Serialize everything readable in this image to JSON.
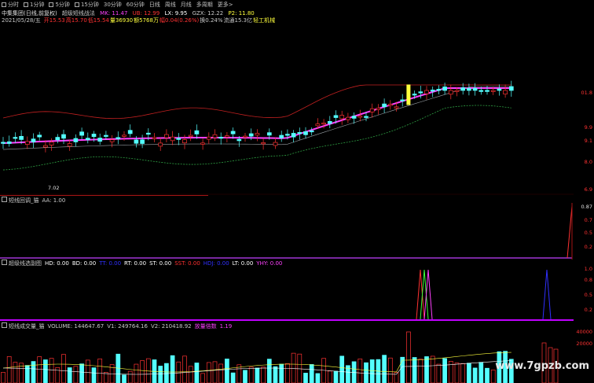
{
  "toolbar": {
    "items": [
      "分时",
      "1分钟",
      "5分钟",
      "15分钟",
      "30分钟",
      "60分钟",
      "日线",
      "周线",
      "月线",
      "多周期",
      "更多>"
    ]
  },
  "main": {
    "title_row": {
      "stock": "中集集团(日线,前复权)",
      "indicator": "超级短线战法",
      "mk": "MK: 11.47",
      "ub": "UB: 12.99",
      "lx": "LX: 9.95",
      "gzx": "GZX: 12.22",
      "p2": "P2: 11.80"
    },
    "info_row": {
      "date": "2021/05/28/五",
      "open": "开15.53",
      "high": "高15.70",
      "low": "低15.54",
      "vol": "量36930",
      "amount": "额5768万",
      "change": "幅0.04(0.26%)",
      "turnover": "换0.24%",
      "float": "流通15.3亿",
      "sector": "轻工机械"
    },
    "axis": [
      "01.8",
      "9.9",
      "9.1",
      "8.0",
      "6.9"
    ],
    "low_label": "7.02",
    "colors": {
      "up": "#ff3232",
      "down": "#54ffff",
      "ma": "#ff40ff",
      "band": "#c02020",
      "support": "#2ea043",
      "highlight": "#ffff3c"
    }
  },
  "panel2": {
    "title": "短线回调_猫",
    "aa": "AA: 1.00",
    "axis": [
      "0.87",
      "0.7",
      "0.5",
      "0.2"
    ]
  },
  "panel3": {
    "title": "超级线选副图",
    "values": [
      {
        "text": "HD: 0.00",
        "color": "#ffffff"
      },
      {
        "text": "BD: 0.00",
        "color": "#ffffff"
      },
      {
        "text": "TT: 0.00",
        "color": "#3030ff"
      },
      {
        "text": "RT: 0.00",
        "color": "#ffffff"
      },
      {
        "text": "ST: 0.00",
        "color": "#ffffff"
      },
      {
        "text": "SST: 0.00",
        "color": "#ff3030"
      },
      {
        "text": "HDJ: 0.00",
        "color": "#3030ff"
      },
      {
        "text": "LT: 0.00",
        "color": "#ffffff"
      },
      {
        "text": "YHY: 0.00",
        "color": "#ff40ff"
      }
    ],
    "axis": [
      "1.0",
      "0.8",
      "0.5",
      "0.2"
    ]
  },
  "panel4": {
    "title": "短线成交量_猫",
    "volume": "VOLUME: 144647.67",
    "v1": "V1: 249764.16",
    "v2": "V2: 210418.92",
    "signal": "放量倍数",
    "signal_val": "1.19",
    "axis": [
      "40000",
      "20000"
    ]
  },
  "watermark": "www.7gpzb.com"
}
